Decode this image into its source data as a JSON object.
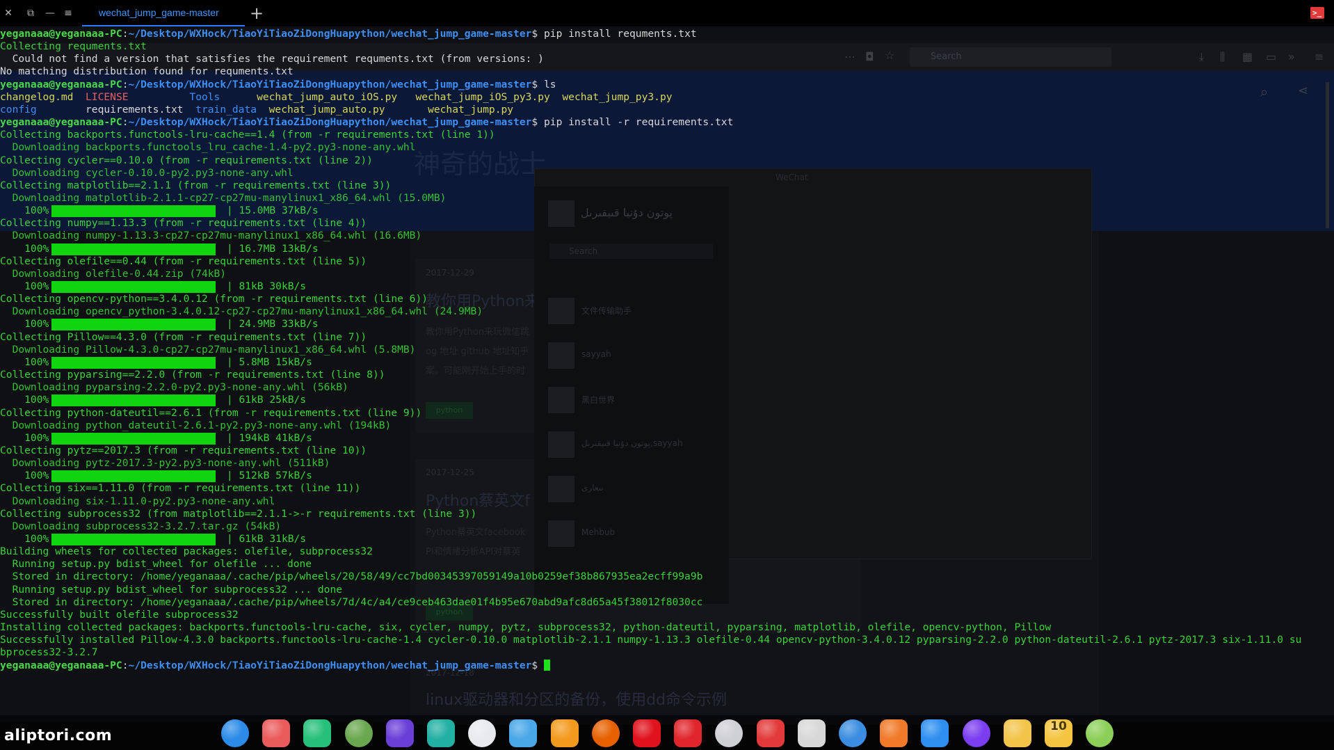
{
  "tab": {
    "title": "wechat_jump_game-master",
    "add_label": "+"
  },
  "window_controls": [
    "✕",
    "⧉",
    "—",
    "≡"
  ],
  "terminal_icon": ">_",
  "prompt": {
    "user": "yeganaaa@yeganaaa-PC",
    "path": "~/Desktop/WXHock/TiaoYiTiaoZiDongHuapython/wechat_jump_game-master"
  },
  "lines": [
    {
      "prompt": true,
      "cmd": "pip install requments.txt"
    },
    {
      "segs": [
        {
          "t": "Collecting requments.txt",
          "c": "g"
        }
      ]
    },
    {
      "segs": [
        {
          "t": "  Could not find a version that satisfies the requirement requments.txt (from versions: )",
          "c": "w"
        }
      ]
    },
    {
      "segs": [
        {
          "t": "No matching distribution found for requments.txt",
          "c": "w"
        }
      ]
    },
    {
      "prompt": true,
      "cmd": "ls"
    },
    {
      "segs": [
        {
          "t": "changelog.md  ",
          "c": "file"
        },
        {
          "t": "LICENSE",
          "c": "lic"
        },
        {
          "t": "          ",
          "c": "w"
        },
        {
          "t": "Tools",
          "c": "dir"
        },
        {
          "t": "      ",
          "c": "w"
        },
        {
          "t": "wechat_jump_auto_iOS.py   wechat_jump_iOS_py3.py  wechat_jump_py3.py",
          "c": "file"
        }
      ]
    },
    {
      "segs": [
        {
          "t": "config",
          "c": "dir"
        },
        {
          "t": "        ",
          "c": "w"
        },
        {
          "t": "requirements.txt  ",
          "c": "w"
        },
        {
          "t": "train_data",
          "c": "dir"
        },
        {
          "t": "  ",
          "c": "w"
        },
        {
          "t": "wechat_jump_auto.py       wechat_jump.py",
          "c": "file"
        }
      ]
    },
    {
      "prompt": true,
      "cmd": "pip install -r requirements.txt"
    },
    {
      "segs": [
        {
          "t": "Collecting backports.functools-lru-cache==1.4 (from -r requirements.txt (line 1))",
          "c": "g"
        }
      ]
    },
    {
      "segs": [
        {
          "t": "  Downloading backports.functools_lru_cache-1.4-py2.py3-none-any.whl",
          "c": "dl"
        }
      ]
    },
    {
      "segs": [
        {
          "t": "Collecting cycler==0.10.0 (from -r requirements.txt (line 2))",
          "c": "g"
        }
      ]
    },
    {
      "segs": [
        {
          "t": "  Downloading cycler-0.10.0-py2.py3-none-any.whl",
          "c": "dl"
        }
      ]
    },
    {
      "segs": [
        {
          "t": "Collecting matplotlib==2.1.1 (from -r requirements.txt (line 3))",
          "c": "g"
        }
      ]
    },
    {
      "segs": [
        {
          "t": "  Downloading matplotlib-2.1.1-cp27-cp27mu-manylinux1_x86_64.whl (15.0MB)",
          "c": "dl"
        }
      ]
    },
    {
      "progress": true,
      "pct": "100%",
      "info": "15.0MB 37kB/s"
    },
    {
      "segs": [
        {
          "t": "Collecting numpy==1.13.3 (from -r requirements.txt (line 4))",
          "c": "g"
        }
      ]
    },
    {
      "segs": [
        {
          "t": "  Downloading numpy-1.13.3-cp27-cp27mu-manylinux1_x86_64.whl (16.6MB)",
          "c": "dl"
        }
      ]
    },
    {
      "progress": true,
      "pct": "100%",
      "info": "16.7MB 13kB/s"
    },
    {
      "segs": [
        {
          "t": "Collecting olefile==0.44 (from -r requirements.txt (line 5))",
          "c": "g"
        }
      ]
    },
    {
      "segs": [
        {
          "t": "  Downloading olefile-0.44.zip (74kB)",
          "c": "dl"
        }
      ]
    },
    {
      "progress": true,
      "pct": "100%",
      "info": "81kB 30kB/s"
    },
    {
      "segs": [
        {
          "t": "Collecting opencv-python==3.4.0.12 (from -r requirements.txt (line 6))",
          "c": "g"
        }
      ]
    },
    {
      "segs": [
        {
          "t": "  Downloading opencv_python-3.4.0.12-cp27-cp27mu-manylinux1_x86_64.whl (24.9MB)",
          "c": "dl"
        }
      ]
    },
    {
      "progress": true,
      "pct": "100%",
      "info": "24.9MB 33kB/s"
    },
    {
      "segs": [
        {
          "t": "Collecting Pillow==4.3.0 (from -r requirements.txt (line 7))",
          "c": "g"
        }
      ]
    },
    {
      "segs": [
        {
          "t": "  Downloading Pillow-4.3.0-cp27-cp27mu-manylinux1_x86_64.whl (5.8MB)",
          "c": "dl"
        }
      ]
    },
    {
      "progress": true,
      "pct": "100%",
      "info": "5.8MB 15kB/s"
    },
    {
      "segs": [
        {
          "t": "Collecting pyparsing==2.2.0 (from -r requirements.txt (line 8))",
          "c": "g"
        }
      ]
    },
    {
      "segs": [
        {
          "t": "  Downloading pyparsing-2.2.0-py2.py3-none-any.whl (56kB)",
          "c": "dl"
        }
      ]
    },
    {
      "progress": true,
      "pct": "100%",
      "info": "61kB 25kB/s"
    },
    {
      "segs": [
        {
          "t": "Collecting python-dateutil==2.6.1 (from -r requirements.txt (line 9))",
          "c": "g"
        }
      ]
    },
    {
      "segs": [
        {
          "t": "  Downloading python_dateutil-2.6.1-py2.py3-none-any.whl (194kB)",
          "c": "dl"
        }
      ]
    },
    {
      "progress": true,
      "pct": "100%",
      "info": "194kB 41kB/s"
    },
    {
      "segs": [
        {
          "t": "Collecting pytz==2017.3 (from -r requirements.txt (line 10))",
          "c": "g"
        }
      ]
    },
    {
      "segs": [
        {
          "t": "  Downloading pytz-2017.3-py2.py3-none-any.whl (511kB)",
          "c": "dl"
        }
      ]
    },
    {
      "progress": true,
      "pct": "100%",
      "info": "512kB 57kB/s"
    },
    {
      "segs": [
        {
          "t": "Collecting six==1.11.0 (from -r requirements.txt (line 11))",
          "c": "g"
        }
      ]
    },
    {
      "segs": [
        {
          "t": "  Downloading six-1.11.0-py2.py3-none-any.whl",
          "c": "dl"
        }
      ]
    },
    {
      "segs": [
        {
          "t": "Collecting subprocess32 (from matplotlib==2.1.1->-r requirements.txt (line 3))",
          "c": "g"
        }
      ]
    },
    {
      "segs": [
        {
          "t": "  Downloading subprocess32-3.2.7.tar.gz (54kB)",
          "c": "dl"
        }
      ]
    },
    {
      "progress": true,
      "pct": "100%",
      "info": "61kB 31kB/s"
    },
    {
      "segs": [
        {
          "t": "Building wheels for collected packages: olefile, subprocess32",
          "c": "g"
        }
      ]
    },
    {
      "segs": [
        {
          "t": "  Running setup.py bdist_wheel for olefile ... done",
          "c": "g"
        }
      ]
    },
    {
      "segs": [
        {
          "t": "  Stored in directory: /home/yeganaaa/.cache/pip/wheels/20/58/49/cc7bd00345397059149a10b0259ef38b867935ea2ecff99a9b",
          "c": "g"
        }
      ]
    },
    {
      "segs": [
        {
          "t": "  Running setup.py bdist_wheel for subprocess32 ... done",
          "c": "g"
        }
      ]
    },
    {
      "segs": [
        {
          "t": "  Stored in directory: /home/yeganaaa/.cache/pip/wheels/7d/4c/a4/ce9ceb463dae01f4b95e670abd9afc8d65a45f38012f8030cc",
          "c": "g"
        }
      ]
    },
    {
      "segs": [
        {
          "t": "Successfully built olefile subprocess32",
          "c": "g"
        }
      ]
    },
    {
      "segs": [
        {
          "t": "Installing collected packages: backports.functools-lru-cache, six, cycler, numpy, pytz, subprocess32, python-dateutil, pyparsing, matplotlib, olefile, opencv-python, Pillow",
          "c": "g"
        }
      ]
    },
    {
      "segs": [
        {
          "t": "Successfully installed Pillow-4.3.0 backports.functools-lru-cache-1.4 cycler-0.10.0 matplotlib-2.1.1 numpy-1.13.3 olefile-0.44 opencv-python-3.4.0.12 pyparsing-2.2.0 python-dateutil-2.6.1 pytz-2017.3 six-1.11.0 su",
          "c": "g"
        }
      ]
    },
    {
      "segs": [
        {
          "t": "bprocess32-3.2.7",
          "c": "g"
        }
      ]
    },
    {
      "prompt": true,
      "cmd": "",
      "cursor": true
    }
  ],
  "background": {
    "search_placeholder": "Search",
    "hero_title": "神奇的战士",
    "chat_title": "WeChat",
    "chat_user": "پوتون دۇنيا قىيقىرىل",
    "chat_search": "Search",
    "contacts": [
      "文件传输助手",
      "sayyah",
      "黑白世界",
      "پوتون دۇنيا قىيقىرىل,sayyah",
      "بىغارى",
      "Mehbub"
    ],
    "dates": [
      "2017-12-29",
      "2017-12-25",
      "2017-12-18"
    ],
    "post_titles": [
      "教你用Python来",
      "Python蔡英文f"
    ],
    "post_snippets": [
      "教你用Python来玩微信跳",
      "og 地址 github 地址知乎",
      "案。可能刚开始上手的时",
      "Python蔡英文facebook",
      "PI和情绪分析API对蔡英"
    ],
    "tag_label": "python",
    "article_title": "linux驱动器和分区的备份，使用dd命令示例"
  },
  "watermark": "aliptori.com",
  "dock": [
    {
      "name": "launcher-icon",
      "color": "#2c8be8"
    },
    {
      "name": "screen-recorder-icon",
      "color": "#ea5b5b"
    },
    {
      "name": "file-manager-icon",
      "color": "#27c07a"
    },
    {
      "name": "android-studio-icon",
      "color": "#6aa84f"
    },
    {
      "name": "intellij-idea-icon",
      "color": "#6a3fd8"
    },
    {
      "name": "clion-icon",
      "color": "#22b0a4"
    },
    {
      "name": "chrome-icon",
      "color": "#e8eaed"
    },
    {
      "name": "archive-manager-icon",
      "color": "#4aa7e8"
    },
    {
      "name": "app-store-icon",
      "color": "#f39a1e"
    },
    {
      "name": "firefox-icon",
      "color": "#e66000"
    },
    {
      "name": "opera-icon",
      "color": "#e0121d"
    },
    {
      "name": "netease-music-icon",
      "color": "#e0262d"
    },
    {
      "name": "settings-icon",
      "color": "#cfcfd6"
    },
    {
      "name": "terminal-icon",
      "color": "#e23a3a"
    },
    {
      "name": "wechat-icon",
      "color": "#d8d8d8"
    },
    {
      "name": "deepin-chat-icon",
      "color": "#3a8de0"
    },
    {
      "name": "downloader-icon",
      "color": "#f07a2a"
    },
    {
      "name": "wifi-icon",
      "color": "#2f8ff0"
    },
    {
      "name": "power-icon",
      "color": "#7a3df0"
    },
    {
      "name": "clock-icon",
      "color": "#f3c44a"
    },
    {
      "name": "calendar-icon",
      "color": "#f5c542"
    },
    {
      "name": "trash-icon",
      "color": "#8ccf58"
    }
  ],
  "calendar_text": "10"
}
